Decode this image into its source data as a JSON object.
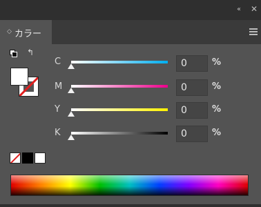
{
  "window": {
    "collapse_icon": "double-chevron-left-icon",
    "close_icon": "close-icon",
    "collapse_glyph": "‹‹",
    "close_glyph": "✕"
  },
  "tab": {
    "label": "カラー",
    "arrows_glyph": "◇"
  },
  "panel_menu_icon": "hamburger-menu-icon",
  "fill_stroke": {
    "swap_glyph": "↰"
  },
  "channels": [
    {
      "label": "C",
      "value": "0",
      "unit": "%",
      "color": "#00aeef"
    },
    {
      "label": "M",
      "value": "0",
      "unit": "%",
      "color": "#ec008c"
    },
    {
      "label": "Y",
      "value": "0",
      "unit": "%",
      "color": "#fff200"
    },
    {
      "label": "K",
      "value": "0",
      "unit": "%",
      "color": "#000000"
    }
  ],
  "colors": {
    "panel_bg": "#535353",
    "none_slash": "#e02020"
  }
}
